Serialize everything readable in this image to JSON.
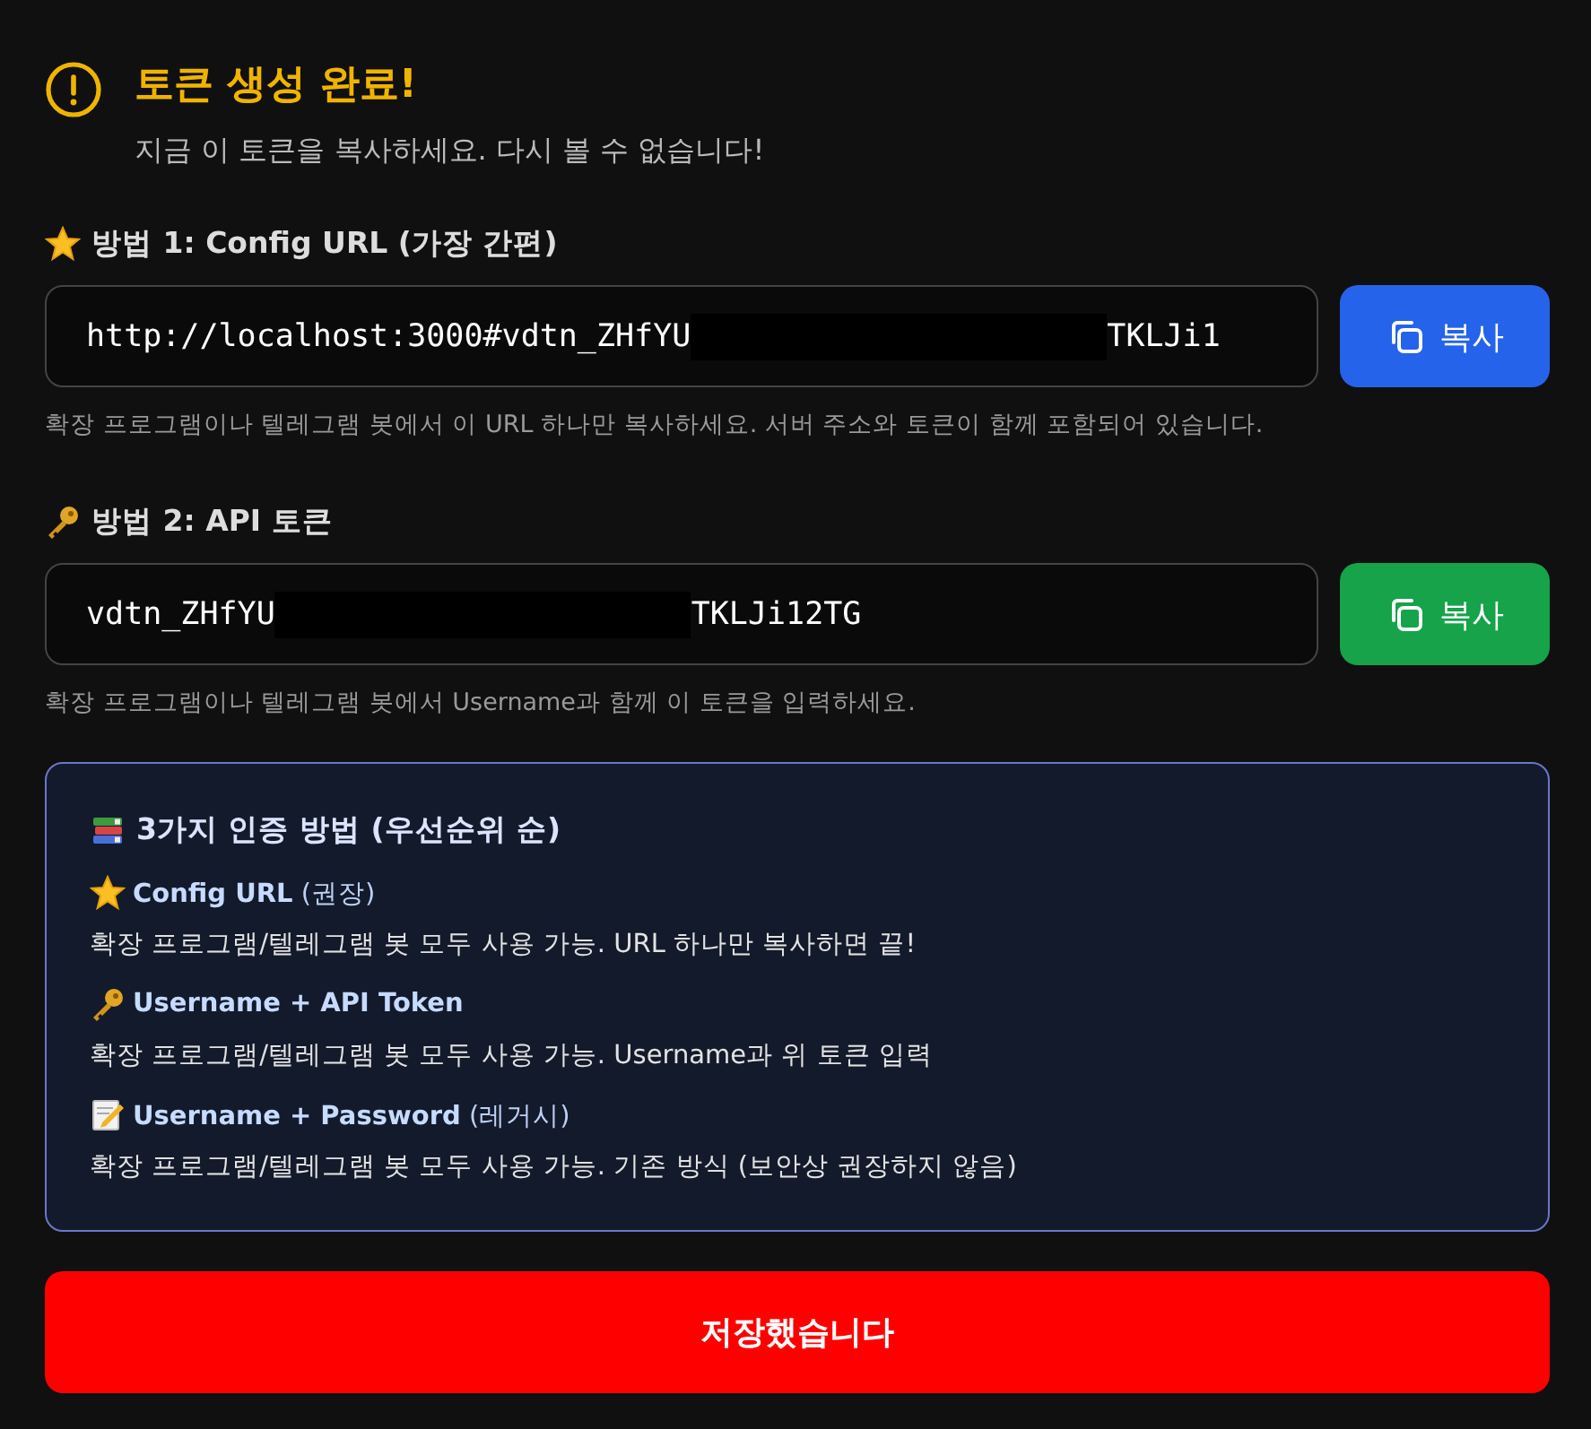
{
  "alert": {
    "title": "토큰 생성 완료!",
    "message": "지금 이 토큰을 복사하세요. 다시 볼 수 없습니다!"
  },
  "methods": [
    {
      "kind": "star",
      "label": "방법 1: Config URL (가장 간편)",
      "value_start": "http://localhost:3000#vdtn_ZHfYU",
      "redacted": true,
      "value_end": "TKLJi1",
      "button": {
        "label": "복사",
        "color": "#2563eb"
      },
      "help": "확장 프로그램이나 텔레그램 봇에서 이 URL 하나만 복사하세요. 서버 주소와 토큰이 함께 포함되어 있습니다."
    },
    {
      "kind": "key",
      "label": "방법 2: API 토큰",
      "value_start": "vdtn_ZHfYU",
      "redacted": true,
      "value_end": "TKLJi12TG",
      "button": {
        "label": "복사",
        "color": "#16a34a"
      },
      "help": "확장 프로그램이나 텔레그램 봇에서 Username과 함께 이 토큰을 입력하세요."
    }
  ],
  "info": {
    "kind": "books",
    "title": "3가지 인증 방법 (우선순위 순)",
    "items": [
      {
        "kind": "star",
        "name": "**Config URL** (권장)",
        "description": "확장 프로그램/텔레그램 봇 모두 사용 가능. URL 하나만 복사하면 끝!"
      },
      {
        "kind": "key",
        "name": "**Username + API Token**",
        "description": "확장 프로그램/텔레그램 봇 모두 사용 가능. Username과 위 토큰 입력"
      },
      {
        "kind": "memo",
        "name": "**Username + Password** (레거시)",
        "description": "확장 프로그램/텔레그램 봇 모두 사용 가능. 기존 방식 (보안상 권장하지 않음)"
      }
    ]
  },
  "save_button": {
    "label": "저장했습니다"
  }
}
